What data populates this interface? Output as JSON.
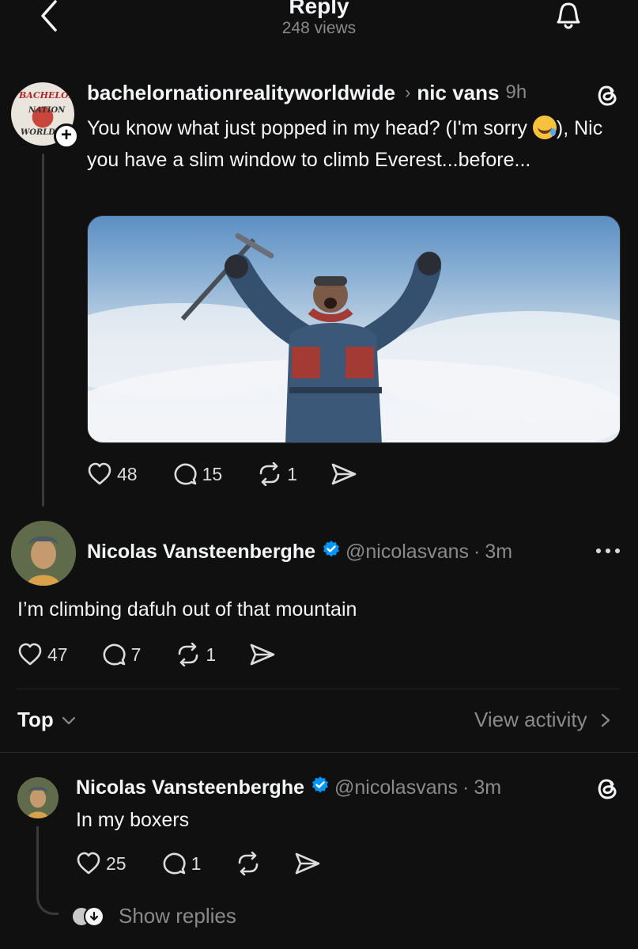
{
  "header": {
    "title": "Reply",
    "views": "248 views"
  },
  "parent_post": {
    "avatar_text": [
      "BACHELOR",
      "NATION",
      "WORLDV"
    ],
    "username": "bachelornationrealityworldwide",
    "reply_to": "nic vans",
    "time": "9h",
    "text_before_emoji": "You know what just popped in my head? (I'm sorry ",
    "emoji": "rolling-on-the-floor-laughing-emoji",
    "text_after_emoji": "), Nic you have a slim window to climb Everest...before...",
    "media_alt": "climber raising ice axe on a mountain summit",
    "likes": "48",
    "comments": "15",
    "reposts": "1"
  },
  "main_post": {
    "name": "Nicolas Vansteenberghe",
    "handle": "@nicolasvans",
    "separator": "·",
    "time": "3m",
    "text": "I’m climbing dafuh out of that mountain",
    "likes": "47",
    "comments": "7",
    "reposts": "1"
  },
  "sort_bar": {
    "sort_label": "Top",
    "view_activity_label": "View activity"
  },
  "reply": {
    "name": "Nicolas Vansteenberghe",
    "handle": "@nicolasvans",
    "separator": "·",
    "time": "3m",
    "text": "In my boxers",
    "likes": "25",
    "comments": "1",
    "show_replies_label": "Show replies"
  },
  "colors": {
    "background": "#101010",
    "text": "#f3f5f7",
    "muted": "#8a8a8a",
    "verified": "#0095f6"
  }
}
